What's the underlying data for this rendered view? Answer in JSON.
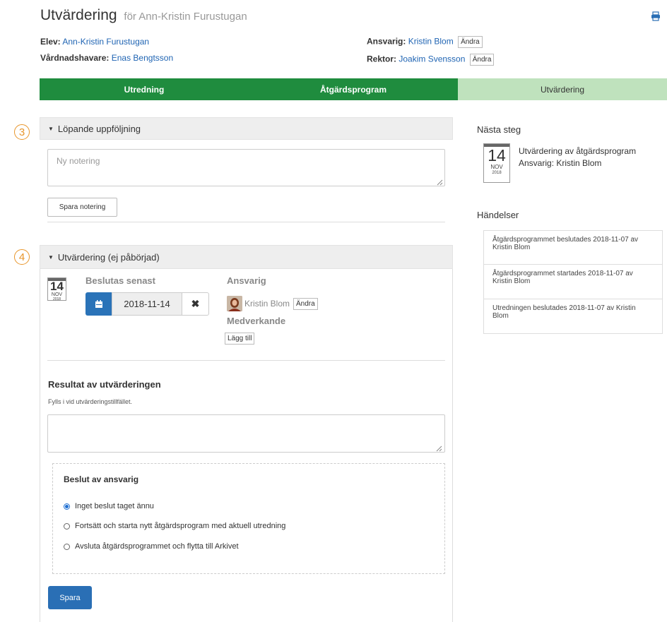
{
  "header": {
    "title": "Utvärdering",
    "subtitle": "för Ann-Kristin Furustugan",
    "student_label": "Elev:",
    "student_name": "Ann-Kristin Furustugan",
    "guardian_label": "Vårdnadshavare:",
    "guardian_name": "Enas Bengtsson",
    "responsible_label": "Ansvarig:",
    "responsible_name": "Kristin Blom",
    "principal_label": "Rektor:",
    "principal_name": "Joakim Svensson",
    "change_label": "Ändra",
    "print_icon": "print-icon"
  },
  "steps": [
    {
      "label": "Utredning",
      "state": "done"
    },
    {
      "label": "Åtgärdsprogram",
      "state": "done"
    },
    {
      "label": "Utvärdering",
      "state": "current"
    }
  ],
  "followup": {
    "number": "3",
    "title": "Löpande uppföljning",
    "note_placeholder": "Ny notering",
    "save_note_label": "Spara notering"
  },
  "evaluation": {
    "number": "4",
    "title": "Utvärdering (ej påbörjad)",
    "calendar": {
      "day": "14",
      "month": "NOV",
      "year": "2018"
    },
    "deadline_label": "Beslutas senast",
    "deadline_value": "2018-11-14",
    "clear_icon": "✖",
    "responsible_label": "Ansvarig",
    "responsible_name": "Kristin Blom",
    "change_label": "Ändra",
    "collaborators_label": "Medverkande",
    "add_label": "Lägg till",
    "result_title": "Resultat av utvärderingen",
    "result_hint": "Fylls i vid utvärderingstillfället.",
    "decision_title": "Beslut av ansvarig",
    "decision_options": [
      {
        "label": "Inget beslut taget ännu",
        "checked": true
      },
      {
        "label": "Fortsätt och starta nytt åtgärdsprogram med aktuell utredning",
        "checked": false
      },
      {
        "label": "Avsluta åtgärdsprogrammet och flytta till Arkivet",
        "checked": false
      }
    ],
    "save_label": "Spara"
  },
  "next_step": {
    "title": "Nästa steg",
    "calendar": {
      "day": "14",
      "month": "NOV",
      "year": "2018"
    },
    "text": "Utvärdering av åtgärdsprogram",
    "responsible": "Ansvarig: Kristin Blom"
  },
  "events": {
    "title": "Händelser",
    "items": [
      "Åtgärdsprogrammet beslutades 2018-11-07 av Kristin Blom",
      "Åtgärdsprogrammet startades 2018-11-07 av Kristin Blom",
      "Utredningen beslutades 2018-11-07 av Kristin Blom"
    ]
  },
  "colors": {
    "step_done": "#1f8c3e",
    "step_current": "#bfe2bd",
    "link": "#1f64b3",
    "accent_number": "#e8952a",
    "primary_button": "#2a6fb5"
  }
}
